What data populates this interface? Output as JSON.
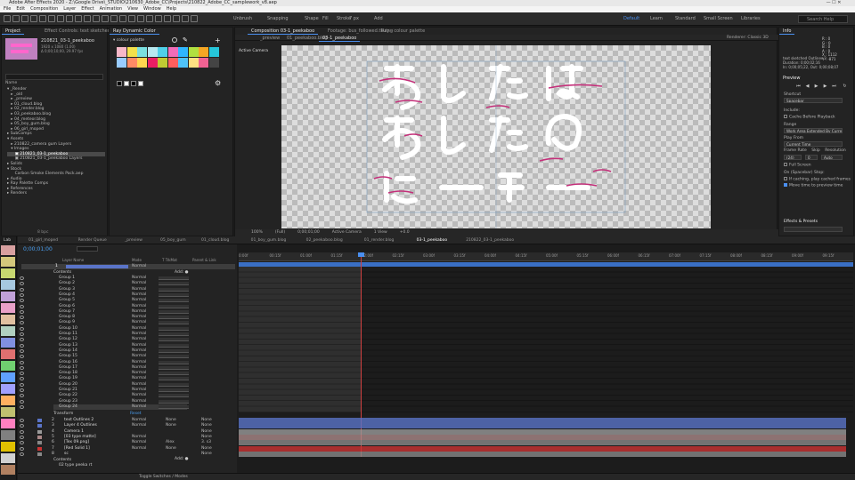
{
  "window": {
    "title": "Adobe After Effects 2020 - Z:\\Google Drive\\_STUDIO\\210630_Adobe_CC\\Projects\\210822_Adobe_CC_samplework_v8.aep",
    "controls": "—   ☐   ✕"
  },
  "menu": [
    "File",
    "Edit",
    "Composition",
    "Layer",
    "Effect",
    "Animation",
    "View",
    "Window",
    "Help"
  ],
  "toolbar": {
    "labels": [
      "Unbrush",
      "Snapping",
      "Shape",
      "Fill",
      "Stroke",
      "7 px",
      "Add"
    ],
    "workspaces": [
      "Default",
      "Learn",
      "Standard",
      "Small Screen",
      "Libraries"
    ],
    "active_workspace": "Default",
    "search_placeholder": "Search Help"
  },
  "project": {
    "tabs": [
      "Project",
      "Effect Controls: text sketched",
      "Ray Dynamic Color"
    ],
    "comp_name": "210821_03-1_peekaboo",
    "comp_info": [
      "1920 x 1080 (1.00)",
      "Δ 0;00;10;00, 29.97 fps"
    ],
    "search_placeholder": "",
    "col_name": "Name",
    "tree": [
      "▾ _Render",
      "   ▸ _old",
      "   ▸ _preview",
      "   ▸ 01_cloud.blog",
      "   ▸ 02_render.blog",
      "   ▸ 03_peekaboo.blog",
      "   ▸ 04_meteor.blog",
      "   ▸ 05_boy_gum.blog",
      "   ▸ 06_girl_moped",
      "▸ SubComps",
      "▾ Assets",
      "   ▸ 210822_camera gum Layers",
      "   ▾ Images",
      "      ▣ 210821_03-1_peekaboo",
      "      ▣ 210821_03-1_peekaboo Layers",
      "▸ Solids",
      "▾ Stock",
      "      Carbon Smoke Elements Pack.aep",
      "▸ Audio",
      "▸ Ray Palette Comps",
      "▸ References",
      "▸ Renders"
    ],
    "footer": "8 bpc"
  },
  "palette": {
    "title": "▾ colour palette",
    "colors": [
      "#f7b8c8",
      "#f3e14b",
      "#7be0e0",
      "#b8e8f0",
      "#50d0e8",
      "#f26cb8",
      "#2fb6ff",
      "#b0e040",
      "#f5a623",
      "#26c6da",
      "#9cf",
      "#ff8a65",
      "#ffd54f",
      "#e91e63",
      "#c0ca33",
      "#ff5e5e",
      "#4fc3f7",
      "#ffe082",
      "#f06292",
      "#444"
    ]
  },
  "comp": {
    "tabs": [
      "Composition 03-1_peekaboo",
      "Footage: bus_followed.tkuing",
      "Ray - colour palette"
    ],
    "subtabs": [
      "_preview",
      "01_peekaboo.blog",
      "03-1_peekaboo"
    ],
    "renderer_label": "Renderer:",
    "renderer": "Classic 3D",
    "view_label": "Active Camera",
    "footer": [
      "100%",
      "(Full)",
      "0;00;01;00",
      "Active Camera",
      "1 View",
      "+0.0"
    ]
  },
  "info": {
    "title": "Info",
    "lines": [
      "R : 0",
      "G : 0",
      "B : 0",
      "A : 0",
      "X : 1112",
      "Y : -871"
    ],
    "layer_name": "text sketched Outlines 2",
    "duration": "Duration: 0;00;02;16",
    "inout": "In: 0;00;05;22, Out: 0;00;08;07"
  },
  "preview": {
    "title": "Preview",
    "shortcut_label": "Shortcut",
    "shortcut": "Spacebar",
    "include_label": "Include:",
    "cache": "Cache Before Playback",
    "range_label": "Range",
    "range": "Work Area Extended By Current...",
    "playfrom_label": "Play From",
    "playfrom": "Current Time",
    "framerate_label": "Frame Rate",
    "skip_label": "Skip",
    "resolution_label": "Resolution",
    "framerate": "(24)",
    "skip": "0",
    "resolution": "Auto",
    "fullscreen": "Full Screen",
    "onstop_label": "On (Spacebar) Stop:",
    "opt1": "If caching, play cached frames",
    "opt2": "Move time to preview time",
    "effects": "Effects & Presets"
  },
  "timeline": {
    "tabs": [
      "01_girl_moped",
      "Render Queue",
      "_preview",
      "05_boy_gum",
      "01_cloud.blog",
      "01_boy_gum.blog",
      "02_peekaboo.blog",
      "01_render.blog",
      "03-1_peekaboo",
      "210822_03-1_peekaboo"
    ],
    "active_tab": "03-1_peekaboo",
    "current_time": "0;00;01;00",
    "cols": [
      "Layer Name",
      "Mode",
      "T TrkMat",
      "Parent & Link"
    ],
    "contents_label": "Contents",
    "add_label": "Add:",
    "mode": "Normal",
    "groups": [
      "Group 1",
      "Group 2",
      "Group 3",
      "Group 4",
      "Group 5",
      "Group 6",
      "Group 7",
      "Group 8",
      "Group 9",
      "Group 10",
      "Group 11",
      "Group 12",
      "Group 13",
      "Group 14",
      "Group 15",
      "Group 16",
      "Group 17",
      "Group 18",
      "Group 19",
      "Group 20",
      "Group 21",
      "Group 22",
      "Group 23",
      "Group 24"
    ],
    "transform": "Transform",
    "reset": "Reset",
    "layers": [
      {
        "num": "2",
        "name": "text Outlines 2",
        "mode": "Normal",
        "trk": "None",
        "parent": "None",
        "color": "#5a74c8"
      },
      {
        "num": "3",
        "name": "Layer 4 Outlines",
        "mode": "Normal",
        "trk": "None",
        "parent": "None",
        "color": "#5a74c8"
      },
      {
        "num": "4",
        "name": "Camera 1",
        "mode": "",
        "trk": "",
        "parent": "None",
        "color": "#9a9a9a"
      },
      {
        "num": "5",
        "name": "[03 type matte]",
        "mode": "Normal",
        "trk": "",
        "parent": "None",
        "color": "#a88"
      },
      {
        "num": "6",
        "name": "[Tex 09.png]",
        "mode": "Normal",
        "trk": "Alex",
        "parent": "3. s3",
        "color": "#888"
      },
      {
        "num": "7",
        "name": "[Red Solid 1]",
        "mode": "Normal",
        "trk": "None",
        "parent": "None",
        "color": "#c33"
      },
      {
        "num": "8",
        "name": "sc",
        "mode": "",
        "trk": "",
        "parent": "None",
        "color": "#888"
      }
    ],
    "bottom": [
      "Contents",
      "02 type peeka rt"
    ],
    "footer": "Toggle Switches / Modes",
    "ticks": [
      "0:00f",
      "00:15f",
      "01:00f",
      "01:15f",
      "02:00f",
      "02:15f",
      "03:00f",
      "03:15f",
      "04:00f",
      "04:15f",
      "05:00f",
      "05:15f",
      "06:00f",
      "06:15f",
      "07:00f",
      "07:15f",
      "08:00f",
      "08:15f",
      "09:00f",
      "09:15f"
    ]
  },
  "sidebar_label": "Lab",
  "sidebar_colors": [
    "#d8a0a0",
    "#d4c87c",
    "#c8d870",
    "#a6c8e0",
    "#c0a0d8",
    "#e8a0c8",
    "#e0c0a0",
    "#b0d0c0",
    "#8090e0",
    "#e07070",
    "#70d070",
    "#60a0ff",
    "#a0a0ff",
    "#ffb060",
    "#c0c070",
    "#ff80c0",
    "#808080",
    "#e0c000",
    "#d0d0d0",
    "#b08060"
  ]
}
